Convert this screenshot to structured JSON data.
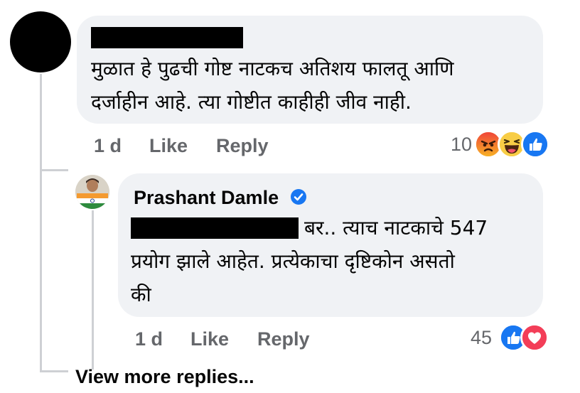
{
  "comment": {
    "text_line1": "मुळात हे पुढची गोष्ट नाटकच अतिशय फालतू आणि",
    "text_line2": "दर्जाहीन आहे.  त्या गोष्टीत काहीही जीव नाही.",
    "time": "1 d",
    "like_label": "Like",
    "reply_label": "Reply",
    "reaction_count": "10",
    "reactions": [
      "angry-reaction-icon",
      "haha-reaction-icon",
      "like-reaction-icon"
    ]
  },
  "reply": {
    "author": "Prashant Damle",
    "verified": "verified-badge-icon",
    "text_line1": "बर.. त्याच नाटकाचे 547",
    "text_line2": "प्रयोग झाले आहेत. प्रत्येकाचा दृष्टिकोन असतो",
    "text_line3": "की",
    "time": "1 d",
    "like_label": "Like",
    "reply_label": "Reply",
    "reaction_count": "45",
    "reactions": [
      "like-reaction-icon",
      "love-reaction-icon"
    ]
  },
  "view_more_label": "View more replies...",
  "colors": {
    "bubble": "#f0f2f5",
    "meta_text": "#65676b",
    "like_blue": "#1877f2",
    "love_red": "#f33e58",
    "verified_blue": "#1877f2",
    "thread_line": "#ced0d4"
  }
}
